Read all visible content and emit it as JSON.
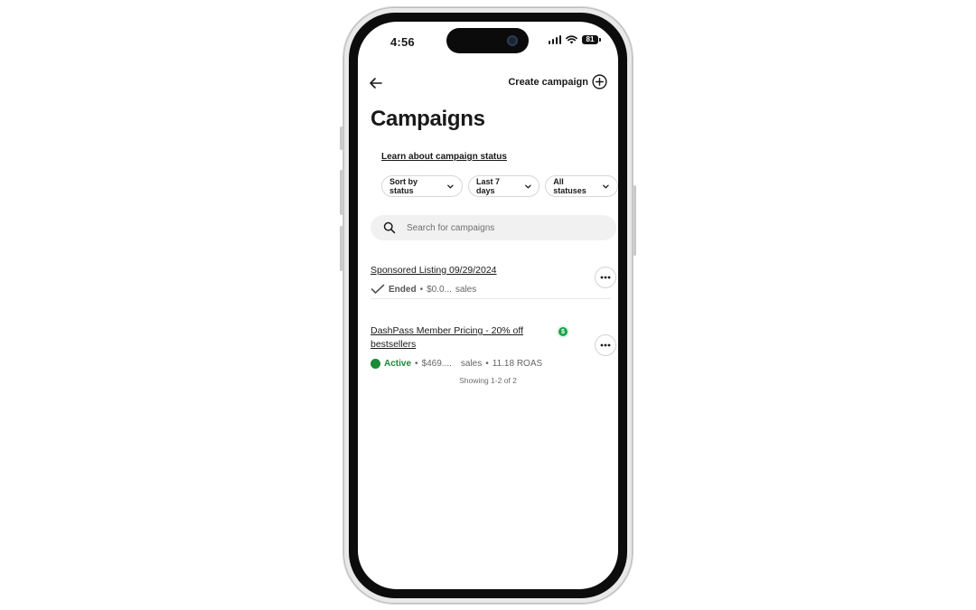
{
  "status_bar": {
    "time": "4:56",
    "battery": "81"
  },
  "header": {
    "back_icon": "arrow-left-icon",
    "create_label": "Create campaign"
  },
  "page": {
    "title": "Campaigns",
    "learn_link": "Learn about campaign status"
  },
  "filters": [
    {
      "label": "Sort by status"
    },
    {
      "label": "Last 7 days"
    },
    {
      "label": "All statuses"
    }
  ],
  "search": {
    "placeholder": "Search for campaigns"
  },
  "campaigns": [
    {
      "name": "Sponsored Listing 09/29/2024",
      "status": "Ended",
      "sep": "•",
      "sales_value": "$0.0...",
      "sales_label": "sales"
    },
    {
      "name_line1": "DashPass Member Pricing - 20% off",
      "name_line2": "bestsellers",
      "badge": "$",
      "status": "Active",
      "sep": "•",
      "sales_value": "$469....",
      "sales_label": "sales",
      "roas": "11.18 ROAS"
    }
  ],
  "footer": {
    "count": "Showing 1-2 of 2"
  },
  "colors": {
    "active": "#1a8a35",
    "badge": "#19a24a",
    "text": "#191919"
  }
}
